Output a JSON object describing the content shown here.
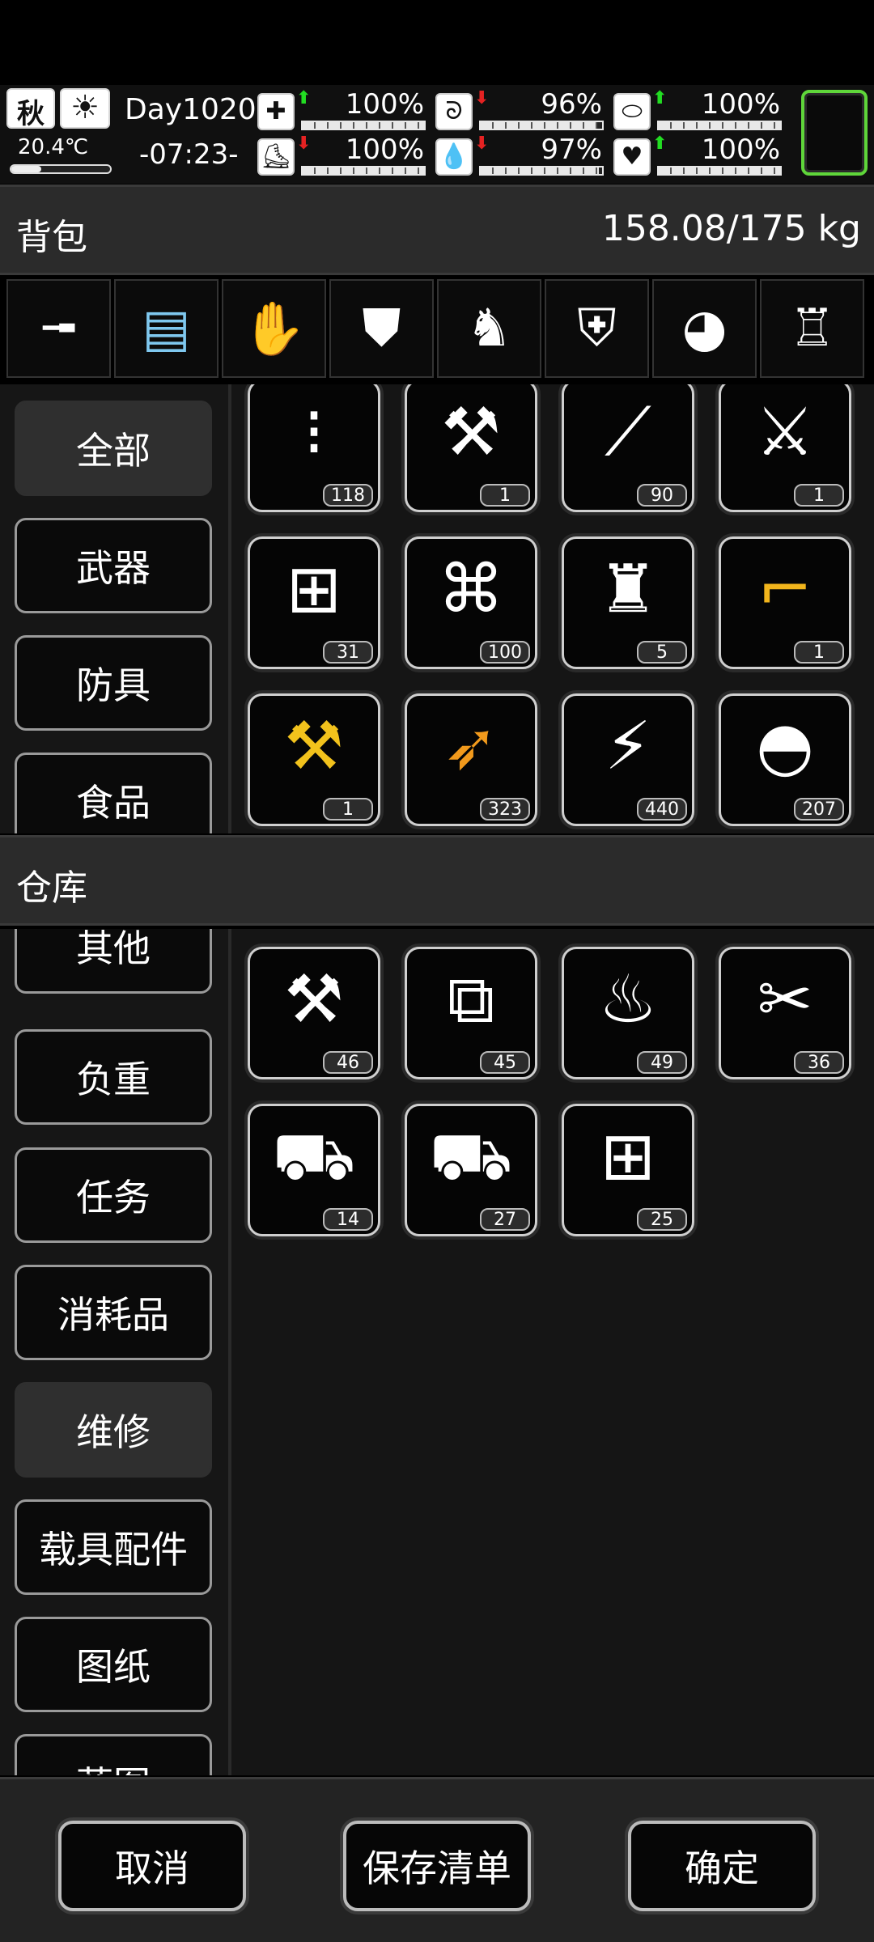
{
  "hud": {
    "season": "秋",
    "weather_icon": "sun-icon",
    "temperature": "20.4℃",
    "day": "Day1020",
    "time": "-07:23-",
    "stats": [
      {
        "name": "health",
        "icon": "medkit-icon",
        "trend": "up",
        "value": "100%",
        "level": 1.0
      },
      {
        "name": "hunger",
        "icon": "stomach-icon",
        "trend": "down",
        "value": "96%",
        "level": 0.96
      },
      {
        "name": "hygiene",
        "icon": "soap-icon",
        "trend": "up",
        "value": "100%",
        "level": 1.0
      },
      {
        "name": "stamina",
        "icon": "boot-icon",
        "trend": "down",
        "value": "100%",
        "level": 1.0
      },
      {
        "name": "thirst",
        "icon": "water-drop-icon",
        "trend": "down",
        "value": "97%",
        "level": 0.97
      },
      {
        "name": "mood",
        "icon": "heart-icon",
        "trend": "up",
        "value": "100%",
        "level": 1.0
      }
    ],
    "accent_color": "#5fd63a"
  },
  "backpack": {
    "title": "背包",
    "weight": "158.08/175 kg",
    "equipment": [
      {
        "slot": "sniper-rifle-icon",
        "glyph": "╼"
      },
      {
        "slot": "minigun-icon",
        "glyph": "▤"
      },
      {
        "slot": "empty-glove-slot-icon",
        "glyph": "✋"
      },
      {
        "slot": "riot-shield-icon",
        "glyph": "⛊"
      },
      {
        "slot": "tactical-vest-icon",
        "glyph": "♞"
      },
      {
        "slot": "armor-chest-icon",
        "glyph": "⛨"
      },
      {
        "slot": "helmet-icon",
        "glyph": "◕"
      },
      {
        "slot": "exoskeleton-icon",
        "glyph": "♖"
      }
    ],
    "categories": [
      "全部",
      "武器",
      "防具",
      "食品"
    ],
    "active_category": "全部",
    "items": [
      {
        "name": "bullets-icon",
        "glyph": "⁝",
        "count": "118",
        "color": "#ffffff"
      },
      {
        "name": "tool-kit-icon",
        "glyph": "⚒",
        "count": "1",
        "color": "#ffffff"
      },
      {
        "name": "cartridge-icon",
        "glyph": "⟋",
        "count": "90",
        "color": "#ffffff"
      },
      {
        "name": "axe-icon",
        "glyph": "⚔",
        "count": "1",
        "color": "#ffffff"
      },
      {
        "name": "toolbox-icon",
        "glyph": "⊞",
        "count": "31",
        "color": "#ffffff"
      },
      {
        "name": "net-icon",
        "glyph": "⌘",
        "count": "100",
        "color": "#ffffff"
      },
      {
        "name": "bottle-icon",
        "glyph": "♜",
        "count": "5",
        "color": "#ffffff"
      },
      {
        "name": "golden-shotgun-icon",
        "glyph": "⌐",
        "count": "1",
        "color": "#f2b51c"
      },
      {
        "name": "golden-hammer-icon",
        "glyph": "⚒",
        "count": "1",
        "color": "#f2c21c"
      },
      {
        "name": "rocket-ammo-icon",
        "glyph": "➶",
        "count": "323",
        "color": "#f29a1c"
      },
      {
        "name": "battery-icon",
        "glyph": "⚡",
        "count": "440",
        "color": "#ffffff"
      },
      {
        "name": "mesh-helmet-icon",
        "glyph": "◓",
        "count": "207",
        "color": "#ffffff"
      }
    ]
  },
  "warehouse": {
    "title": "仓库",
    "categories": [
      "其他",
      "负重",
      "任务",
      "消耗品",
      "维修",
      "载具配件",
      "图纸",
      "蓝图"
    ],
    "active_category": "维修",
    "items": [
      {
        "name": "repair-kit-icon",
        "glyph": "⚒",
        "count": "46"
      },
      {
        "name": "tool-case-icon",
        "glyph": "⧉",
        "count": "45"
      },
      {
        "name": "tool-bag-icon",
        "glyph": "♨",
        "count": "49"
      },
      {
        "name": "pliers-box-icon",
        "glyph": "✂",
        "count": "36"
      },
      {
        "name": "car-repair-kit-icon",
        "glyph": "⛟",
        "count": "14"
      },
      {
        "name": "car-repair-kit-icon-2",
        "glyph": "⛟",
        "count": "27"
      },
      {
        "name": "toolbox-icon",
        "glyph": "⊞",
        "count": "25"
      }
    ]
  },
  "footer": {
    "cancel": "取消",
    "save_list": "保存清单",
    "confirm": "确定"
  }
}
